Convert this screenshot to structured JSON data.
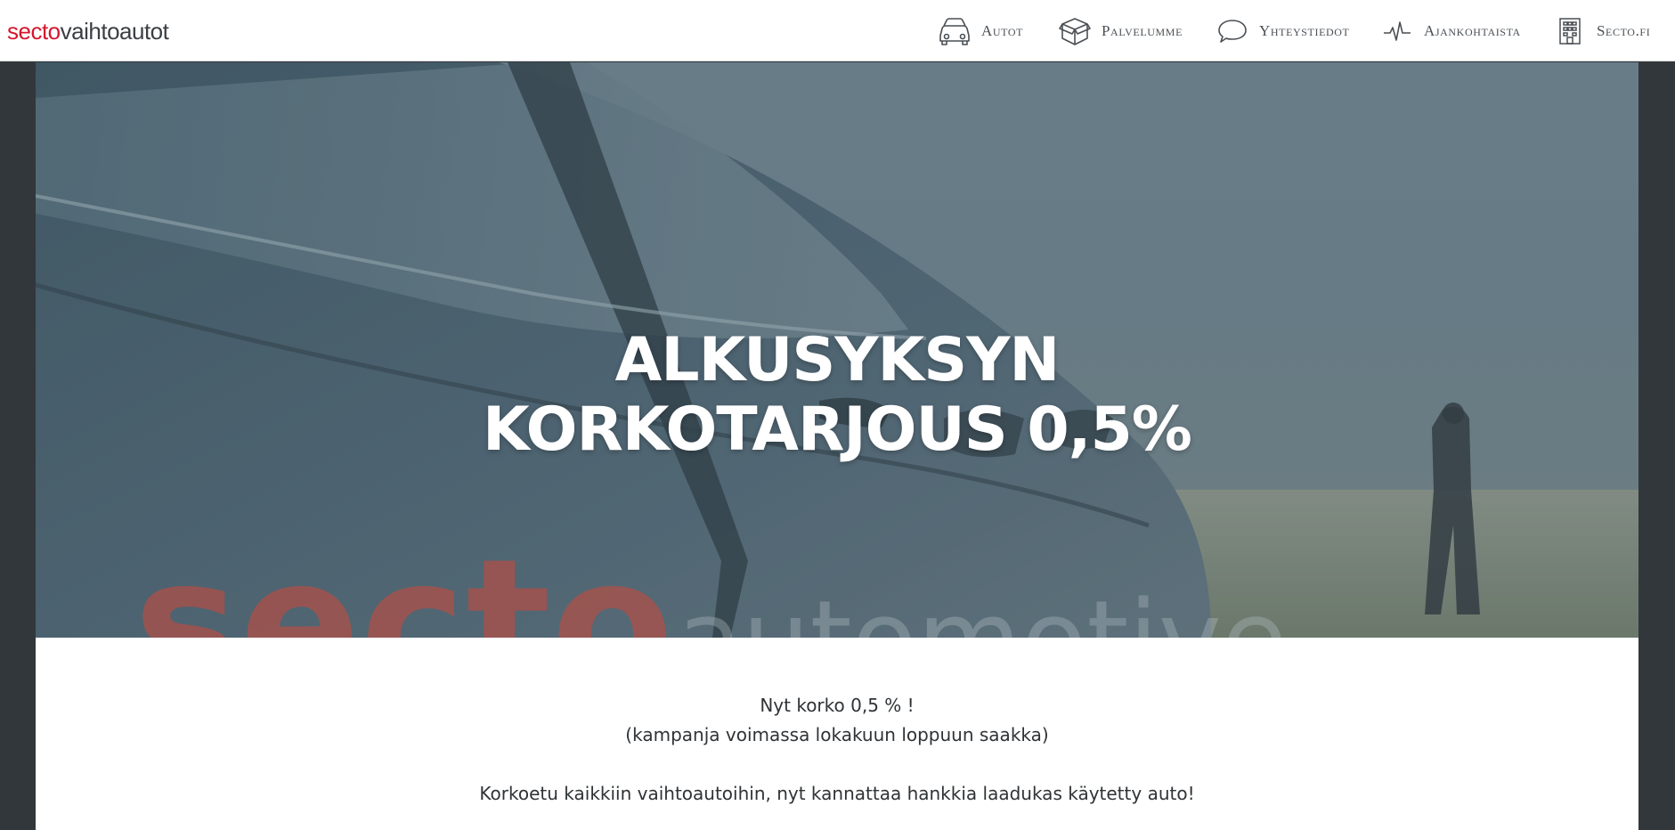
{
  "header": {
    "logo": {
      "brand": "secto",
      "sub": "vaihtoautot"
    },
    "nav": [
      {
        "label": "Autot",
        "icon": "car-icon"
      },
      {
        "label": "Palvelumme",
        "icon": "box-icon"
      },
      {
        "label": "Yhteystiedot",
        "icon": "speech-bubble-icon"
      },
      {
        "label": "Ajankohtaista",
        "icon": "pulse-icon"
      },
      {
        "label": "Secto.fi",
        "icon": "building-icon"
      }
    ]
  },
  "hero": {
    "title_line1": "ALKUSYKSYN",
    "title_line2": "KORKOTARJOUS 0,5%",
    "car_decal_brand": "secto",
    "car_decal_sub": "automotive"
  },
  "content": {
    "line1": "Nyt korko 0,5 % !",
    "line2": "(kampanja voimassa lokakuun loppuun saakka)",
    "line3": "Korkoetu kaikkiin vaihtoautoihin, nyt kannattaa hankkia laadukas käytetty auto!"
  },
  "colors": {
    "brand_red": "#d4172e",
    "page_dark": "#32373b",
    "nav_text": "#4a4f54"
  }
}
